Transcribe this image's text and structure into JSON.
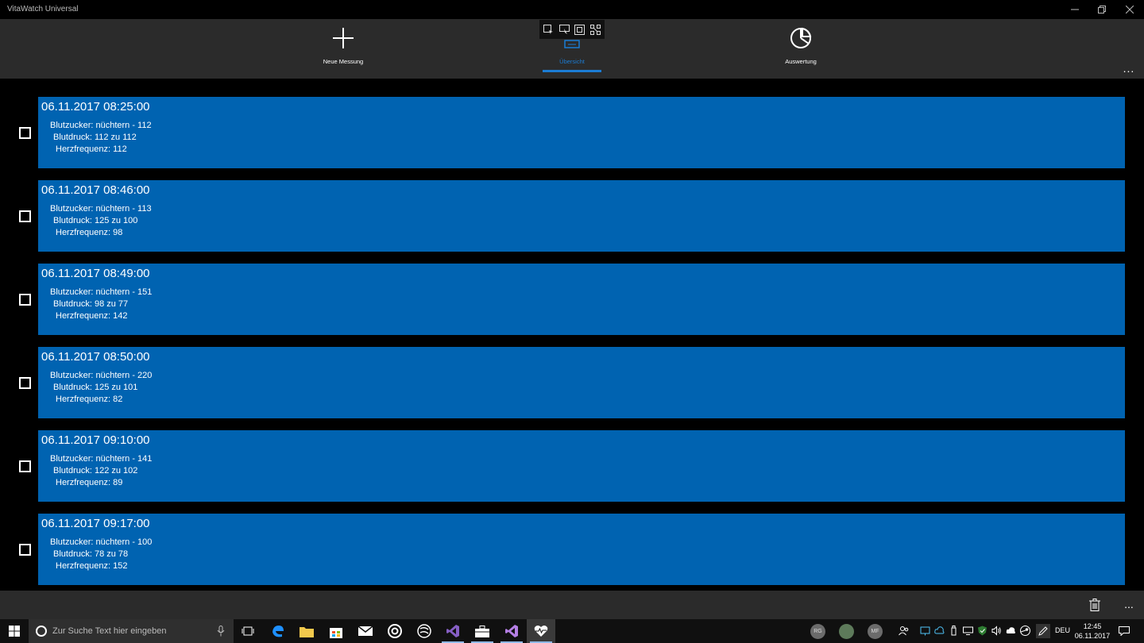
{
  "window": {
    "title": "VitaWatch Universal",
    "controls": [
      "minimize-icon",
      "restore-icon",
      "close-icon"
    ]
  },
  "nav": {
    "items": [
      {
        "label": "Neue Messung",
        "icon": "plus-icon"
      },
      {
        "label": "Übersicht",
        "icon": "list-icon",
        "selected": true
      },
      {
        "label": "Auswertung",
        "icon": "pie-chart-icon"
      }
    ],
    "more": "..."
  },
  "overlay_toolbar": {
    "icons": [
      "select-element-icon",
      "display-layout-icon",
      "track-focus-icon",
      "live-tree-icon"
    ]
  },
  "measurements": [
    {
      "datetime": "06.11.2017 08:25:00",
      "blutzucker": "Blutzucker: nüchtern - 112",
      "blutdruck": "Blutdruck: 112 zu 112",
      "herzfrequenz": "Herzfrequenz: 112"
    },
    {
      "datetime": "06.11.2017 08:46:00",
      "blutzucker": "Blutzucker: nüchtern - 113",
      "blutdruck": "Blutdruck: 125 zu 100",
      "herzfrequenz": "Herzfrequenz: 98"
    },
    {
      "datetime": "06.11.2017 08:49:00",
      "blutzucker": "Blutzucker: nüchtern - 151",
      "blutdruck": "Blutdruck: 98 zu 77",
      "herzfrequenz": "Herzfrequenz: 142"
    },
    {
      "datetime": "06.11.2017 08:50:00",
      "blutzucker": "Blutzucker: nüchtern - 220",
      "blutdruck": "Blutdruck: 125 zu 101",
      "herzfrequenz": "Herzfrequenz: 82"
    },
    {
      "datetime": "06.11.2017 09:10:00",
      "blutzucker": "Blutzucker: nüchtern - 141",
      "blutdruck": "Blutdruck: 122 zu 102",
      "herzfrequenz": "Herzfrequenz: 89"
    },
    {
      "datetime": "06.11.2017 09:17:00",
      "blutzucker": "Blutzucker: nüchtern - 100",
      "blutdruck": "Blutdruck: 78 zu 78",
      "herzfrequenz": "Herzfrequenz: 152"
    }
  ],
  "command_bar": {
    "delete_icon": "trash-icon",
    "more": "..."
  },
  "taskbar": {
    "search_placeholder": "Zur Suche Text hier eingeben",
    "apps": [
      "task-view-icon",
      "edge-icon",
      "file-explorer-icon",
      "store-icon",
      "mail-icon",
      "groove-icon",
      "sway-icon",
      "visual-studio-icon",
      "toolbox-icon",
      "visual-studio-alt-icon",
      "vitawatch-icon"
    ],
    "avatars": [
      "RG",
      "",
      "MF"
    ],
    "language": "DEU",
    "time": "12:45",
    "date": "06.11.2017"
  },
  "colors": {
    "accent": "#0063b1",
    "nav_accent": "#1b7cd4",
    "header_bg": "#2b2b2b",
    "background": "#000000"
  }
}
